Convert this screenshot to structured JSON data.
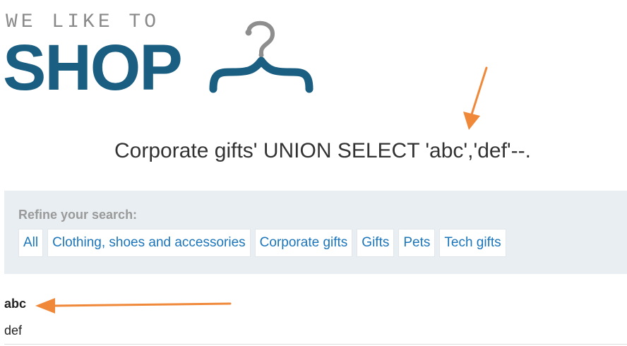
{
  "logo": {
    "tagline": "WE LIKE TO",
    "word": "SHOP",
    "icon": "clothes-hanger-icon",
    "brand_color": "#1a5e82"
  },
  "search_result_heading": "Corporate gifts' UNION SELECT 'abc','def'--.",
  "filter": {
    "label": "Refine your search:",
    "categories": [
      "All",
      "Clothing, shoes and accessories",
      "Corporate gifts",
      "Gifts",
      "Pets",
      "Tech gifts"
    ]
  },
  "results": [
    {
      "title": "abc",
      "description": "def"
    }
  ],
  "annotations": {
    "arrow_color": "#f0883a"
  }
}
